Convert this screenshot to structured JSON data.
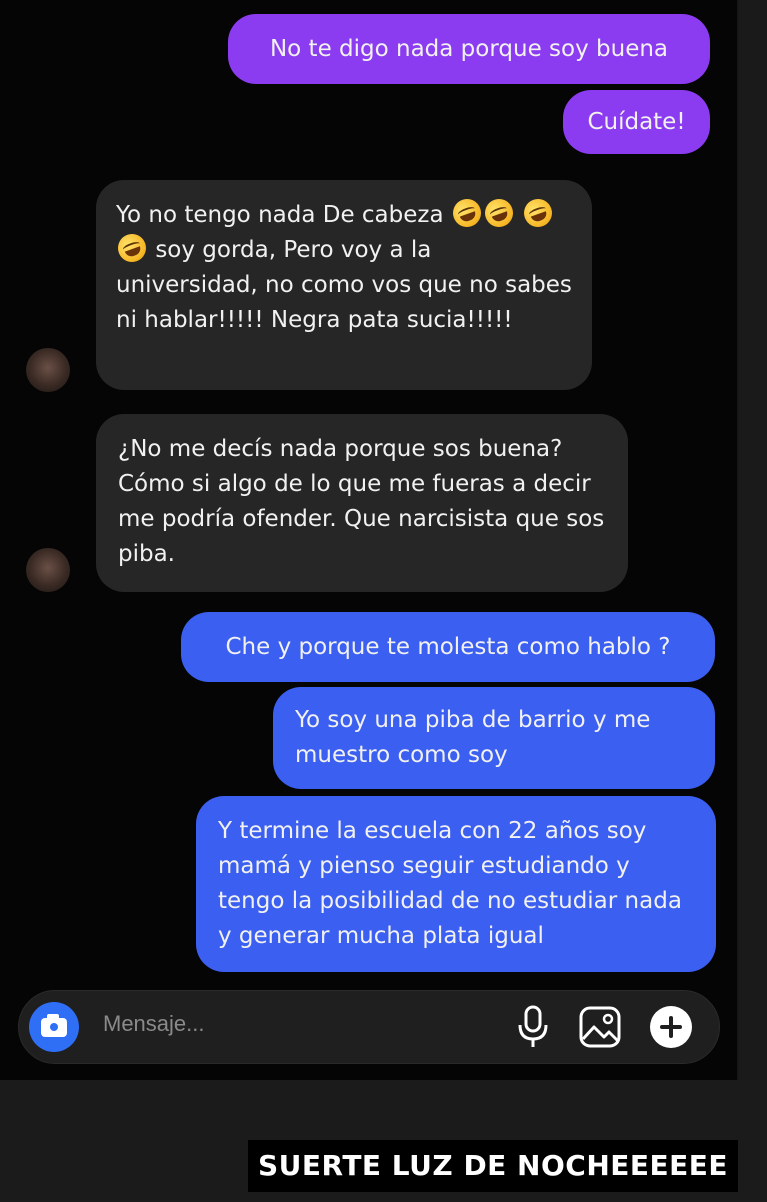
{
  "messages": [
    {
      "text": "No te digo nada porque soy buena"
    },
    {
      "text": "Cuídate!"
    },
    {
      "text_a": "Yo no tengo nada De cabeza",
      "text_b": "soy gorda,  Pero voy a la universidad, no como vos que no sabes ni hablar!!!!! Negra pata sucia!!!!!",
      "emoji": "rolling-on-floor-laughing"
    },
    {
      "text": "¿No me decís nada porque sos buena? Cómo si algo de lo que me fueras a decir me podría ofender. Que narcisista que sos piba."
    },
    {
      "text": "Che y porque te molesta como hablo ?"
    },
    {
      "text": "Yo soy una piba de barrio y me muestro como soy"
    },
    {
      "text": "Y termine la escuela con 22 años soy mamá y pienso seguir estudiando y tengo la posibilidad de no estudiar nada y generar mucha plata igual"
    }
  ],
  "composer": {
    "placeholder": "Mensaje...",
    "icons": [
      "camera-icon",
      "microphone-icon",
      "gallery-icon",
      "plus-icon"
    ]
  },
  "caption": {
    "text": "SUERTE LUZ DE NOCHEEEEEE"
  },
  "colors": {
    "outgoing_purple": "#8b3cf0",
    "outgoing_blue": "#3b5ff0",
    "incoming": "#262626",
    "background": "#050505",
    "camera_button": "#2f6ff6"
  }
}
